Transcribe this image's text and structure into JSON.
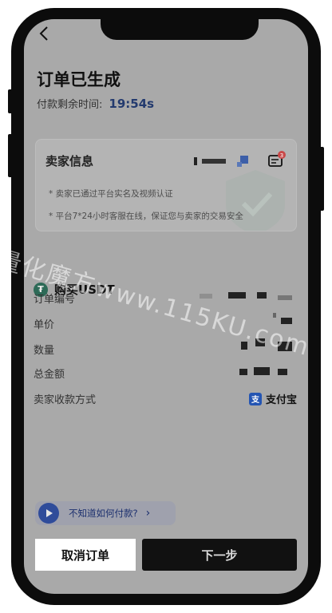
{
  "header": {
    "title": "订单已生成",
    "timer_label": "付款剩余时间:",
    "timer_value": "19:54s"
  },
  "seller": {
    "title": "卖家信息",
    "badge_count": "3",
    "line1": "* 卖家已通过平台实名及视频认证",
    "line2": "* 平台7*24小时客服在线，保证您与卖家的交易安全"
  },
  "order": {
    "coin_label": "购买USDT",
    "rows": [
      {
        "label": "订单编号"
      },
      {
        "label": "单价"
      },
      {
        "label": "数量"
      },
      {
        "label": "总金额"
      },
      {
        "label": "卖家收款方式"
      }
    ],
    "payment_method": "支付宝"
  },
  "help": {
    "text": "不知道如何付款?",
    "arrow": "›"
  },
  "footer": {
    "cancel_label": "取消订单",
    "next_label": "下一步"
  },
  "watermark": "量化魔方www.115KU.com",
  "colors": {
    "screen_bg": "#a9a9a9",
    "accent_blue": "#2f4c9a",
    "timer_blue": "#233a6e",
    "tether_green": "#2d6a57",
    "alipay_blue": "#2455b3"
  },
  "icons": [
    "back-icon",
    "message-icon",
    "shield-icon",
    "tether-icon",
    "alipay-icon",
    "play-icon",
    "chevron-right-icon"
  ]
}
